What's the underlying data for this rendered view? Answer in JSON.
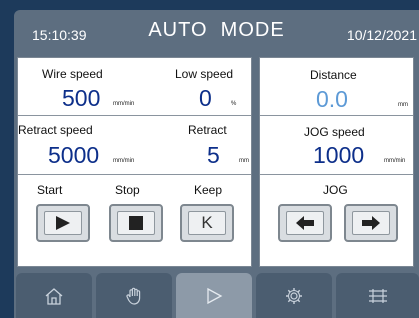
{
  "header": {
    "time": "15:10:39",
    "title": "AUTO  MODE",
    "date": "10/12/2021"
  },
  "left_panel": {
    "wire_speed": {
      "label": "Wire speed",
      "value": "500",
      "unit": "mm/min"
    },
    "low_speed": {
      "label": "Low speed",
      "value": "0",
      "unit": "%"
    },
    "retract_speed": {
      "label": "Retract speed",
      "value": "5000",
      "unit": "mm/min"
    },
    "retract": {
      "label": "Retract",
      "value": "5",
      "unit": "mm"
    },
    "controls": {
      "start_label": "Start",
      "stop_label": "Stop",
      "keep_label": "Keep",
      "keep_button_text": "K"
    }
  },
  "right_panel": {
    "distance": {
      "label": "Distance",
      "value": "0.0",
      "unit": "mm"
    },
    "jog_speed": {
      "label": "JOG speed",
      "value": "1000",
      "unit": "mm/min"
    },
    "jog_label": "JOG"
  },
  "navbar": {
    "items": [
      "home-icon",
      "hand-icon",
      "play-icon",
      "gear-icon",
      "feed-icon"
    ],
    "active_index": 2
  },
  "colors": {
    "value_blue": "#0d2f8a",
    "distance_blue": "#5d9ad6",
    "background": "#1d3a5b",
    "screen": "#5d6e80"
  }
}
